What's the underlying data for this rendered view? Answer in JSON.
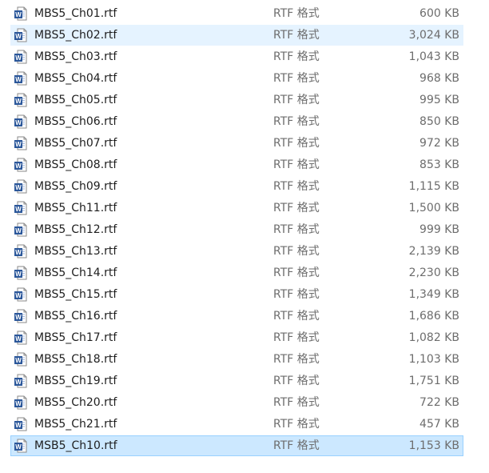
{
  "files": [
    {
      "name": "MBS5_Ch01.rtf",
      "type": "RTF 格式",
      "size": "600 KB",
      "state": ""
    },
    {
      "name": "MBS5_Ch02.rtf",
      "type": "RTF 格式",
      "size": "3,024 KB",
      "state": "hover"
    },
    {
      "name": "MBS5_Ch03.rtf",
      "type": "RTF 格式",
      "size": "1,043 KB",
      "state": ""
    },
    {
      "name": "MBS5_Ch04.rtf",
      "type": "RTF 格式",
      "size": "968 KB",
      "state": ""
    },
    {
      "name": "MBS5_Ch05.rtf",
      "type": "RTF 格式",
      "size": "995 KB",
      "state": ""
    },
    {
      "name": "MBS5_Ch06.rtf",
      "type": "RTF 格式",
      "size": "850 KB",
      "state": ""
    },
    {
      "name": "MBS5_Ch07.rtf",
      "type": "RTF 格式",
      "size": "972 KB",
      "state": ""
    },
    {
      "name": "MBS5_Ch08.rtf",
      "type": "RTF 格式",
      "size": "853 KB",
      "state": ""
    },
    {
      "name": "MBS5_Ch09.rtf",
      "type": "RTF 格式",
      "size": "1,115 KB",
      "state": ""
    },
    {
      "name": "MBS5_Ch11.rtf",
      "type": "RTF 格式",
      "size": "1,500 KB",
      "state": ""
    },
    {
      "name": "MBS5_Ch12.rtf",
      "type": "RTF 格式",
      "size": "999 KB",
      "state": ""
    },
    {
      "name": "MBS5_Ch13.rtf",
      "type": "RTF 格式",
      "size": "2,139 KB",
      "state": ""
    },
    {
      "name": "MBS5_Ch14.rtf",
      "type": "RTF 格式",
      "size": "2,230 KB",
      "state": ""
    },
    {
      "name": "MBS5_Ch15.rtf",
      "type": "RTF 格式",
      "size": "1,349 KB",
      "state": ""
    },
    {
      "name": "MBS5_Ch16.rtf",
      "type": "RTF 格式",
      "size": "1,686 KB",
      "state": ""
    },
    {
      "name": "MBS5_Ch17.rtf",
      "type": "RTF 格式",
      "size": "1,082 KB",
      "state": ""
    },
    {
      "name": "MBS5_Ch18.rtf",
      "type": "RTF 格式",
      "size": "1,103 KB",
      "state": ""
    },
    {
      "name": "MBS5_Ch19.rtf",
      "type": "RTF 格式",
      "size": "1,751 KB",
      "state": ""
    },
    {
      "name": "MBS5_Ch20.rtf",
      "type": "RTF 格式",
      "size": "722 KB",
      "state": ""
    },
    {
      "name": "MBS5_Ch21.rtf",
      "type": "RTF 格式",
      "size": "457 KB",
      "state": ""
    },
    {
      "name": "MSB5_Ch10.rtf",
      "type": "RTF 格式",
      "size": "1,153 KB",
      "state": "selected"
    }
  ],
  "icon": "word-document-icon",
  "colors": {
    "hover_bg": "#e5f3ff",
    "selected_bg": "#cce8ff",
    "selected_border": "#99d1ff",
    "word_blue": "#2b579a"
  }
}
